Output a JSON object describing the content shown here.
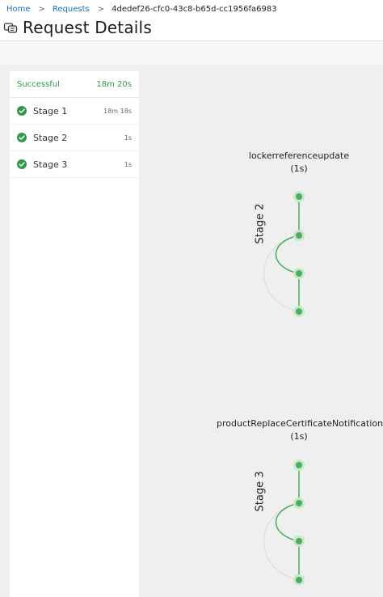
{
  "breadcrumb": {
    "home": "Home",
    "requests": "Requests",
    "current": "4dedef26-cfc0-43c8-b65d-cc1956fa6983"
  },
  "page": {
    "title": "Request Details"
  },
  "summary": {
    "status": "Successful",
    "duration": "18m 20s"
  },
  "stages": [
    {
      "label": "Stage 1",
      "duration": "18m 18s"
    },
    {
      "label": "Stage 2",
      "duration": "1s"
    },
    {
      "label": "Stage 3",
      "duration": "1s"
    }
  ],
  "graph": [
    {
      "stage_label": "Stage 2",
      "step_name": "lockerreferenceupdate",
      "step_duration": "(1s)"
    },
    {
      "stage_label": "Stage 3",
      "step_name": "productReplaceCertificateNotification",
      "step_duration": "(1s)"
    }
  ],
  "colors": {
    "link": "#1a6fb5",
    "success": "#2e9a47",
    "node": "#4caf5c",
    "node_halo": "#c8e8cd"
  }
}
